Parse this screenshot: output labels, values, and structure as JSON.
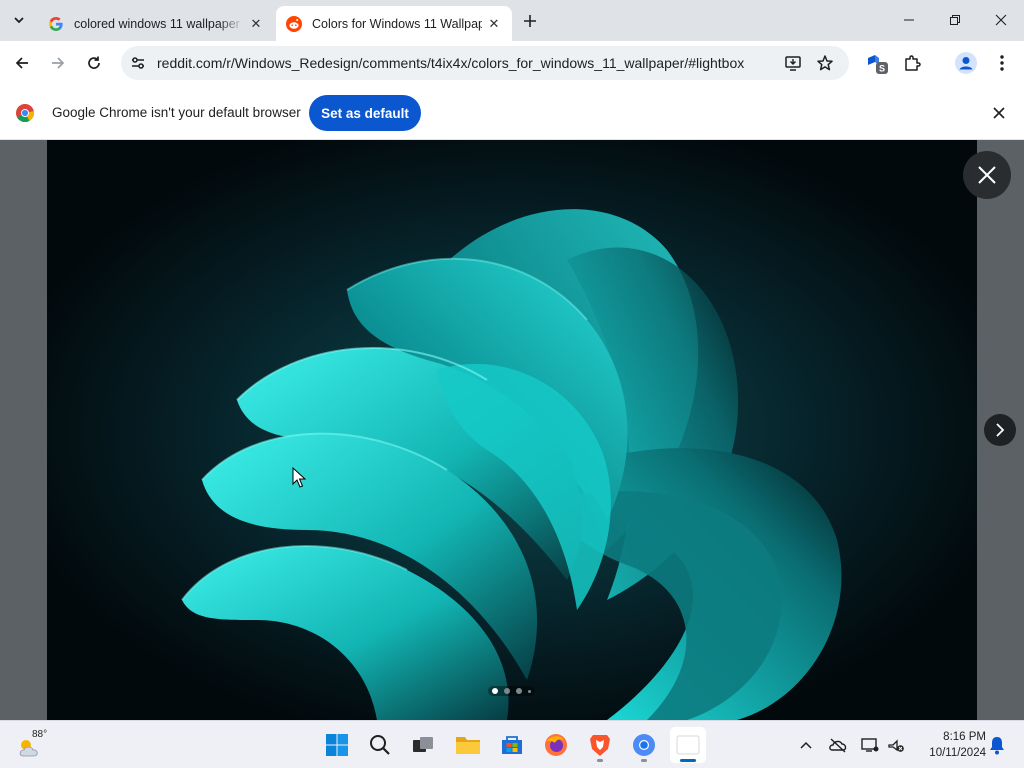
{
  "browser": {
    "tabs": [
      {
        "title": "colored windows 11 wallpaper",
        "favicon": "google-icon",
        "active": false
      },
      {
        "title": "Colors for Windows 11 Wallpap",
        "favicon": "reddit-icon",
        "active": true
      }
    ],
    "address_bar": {
      "url": "reddit.com/r/Windows_Redesign/comments/t4ix4x/colors_for_windows_11_wallpaper/#lightbox"
    },
    "extension_badge": "S",
    "colors": {
      "accent": "#0b57d0",
      "tabstrip": "#dfe3e8"
    }
  },
  "infobar": {
    "message": "Google Chrome isn't your default browser",
    "button_label": "Set as default"
  },
  "lightbox": {
    "image_description_icon": "windows-11-bloom-wallpaper-teal",
    "slide_count": 4,
    "current_slide": 1,
    "colors": {
      "bloom": "#1fd6d6",
      "background": "#031217"
    }
  },
  "taskbar": {
    "weather": {
      "temperature": "88°",
      "icon": "partly-cloudy-icon"
    },
    "apps": [
      {
        "name": "start-button",
        "icon": "windows-logo-icon"
      },
      {
        "name": "search-button",
        "icon": "search-icon"
      },
      {
        "name": "task-view-button",
        "icon": "task-view-icon"
      },
      {
        "name": "file-explorer",
        "icon": "folder-icon"
      },
      {
        "name": "microsoft-store",
        "icon": "store-icon"
      },
      {
        "name": "firefox",
        "icon": "firefox-icon"
      },
      {
        "name": "brave",
        "icon": "brave-icon"
      },
      {
        "name": "chrome",
        "icon": "chrome-icon"
      },
      {
        "name": "active-window",
        "icon": "window-icon"
      }
    ],
    "tray": [
      "chevron-up-icon",
      "onedrive-offline-icon",
      "display-icon",
      "network-muted-icon"
    ],
    "clock": {
      "time": "8:16 PM",
      "date": "10/11/2024"
    }
  }
}
